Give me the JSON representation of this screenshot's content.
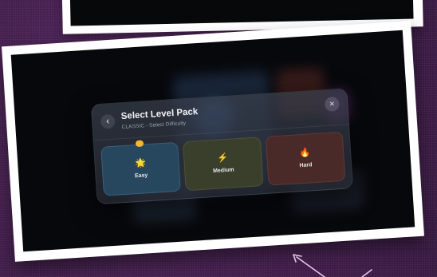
{
  "modal": {
    "title": "Select Level Pack",
    "subtitle": "CLASSIC - Select Difficulty",
    "back_icon": "chevron-left-icon",
    "close_icon": "close-icon",
    "close_glyph": "×",
    "back_glyph": "‹"
  },
  "levels": [
    {
      "label": "Easy",
      "icon": "star-icon",
      "glyph": "🌟",
      "color": "#26475e"
    },
    {
      "label": "Medium",
      "icon": "lightning-icon",
      "glyph": "⚡",
      "color": "#3a3f2c"
    },
    {
      "label": "Hard",
      "icon": "fire-icon",
      "glyph": "🔥",
      "color": "#4a2a28"
    }
  ],
  "colors": {
    "background": "#45204f",
    "photo_border": "#ffffff",
    "badge": "#f5b731",
    "arrow": "#e6c7e8"
  }
}
